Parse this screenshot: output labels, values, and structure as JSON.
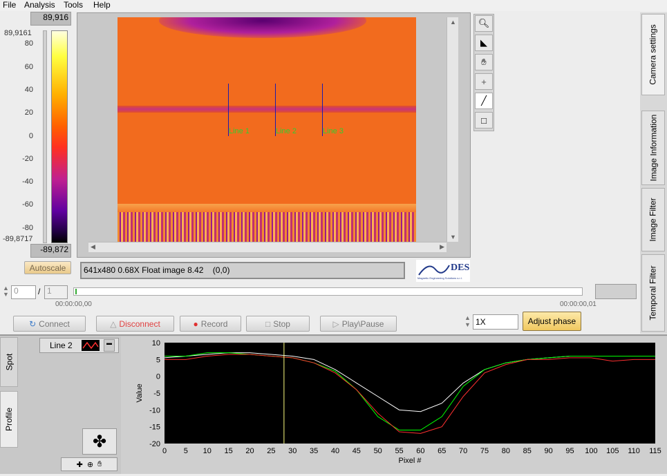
{
  "menu": [
    "File",
    "Analysis",
    "Tools",
    "Help"
  ],
  "colorbar": {
    "max_label": "89,916",
    "min_label": "-89,872",
    "upper_value": "89,9161",
    "lower_value": "-89,8717",
    "ticks": [
      "80",
      "60",
      "40",
      "20",
      "0",
      "-20",
      "-40",
      "-60",
      "-80"
    ]
  },
  "autoscale_label": "Autoscale",
  "image_info": "641x480 0.68X Float image 8.42    (0,0)",
  "lines": [
    "Line 1",
    "Line 2",
    "Line 3"
  ],
  "logo_text": "DES",
  "logo_subtitle": "Magnetic Engineering Solutions s.r.l.",
  "frame": {
    "current": "0",
    "separator": "/",
    "total": "1",
    "time_start": "00:00:00,00",
    "time_end": "00:00:00,01"
  },
  "buttons": {
    "connect": "Connect",
    "disconnect": "Disconnect",
    "record": "Record",
    "stop": "Stop",
    "play_pause": "Play\\Pause",
    "adjust_phase": "Adjust phase"
  },
  "speed_value": "1X",
  "right_tabs": [
    "Camera settings",
    "Image Information",
    "Image Filter",
    "Temporal Filter"
  ],
  "left_tabs": [
    "Spot",
    "Profile"
  ],
  "legend_line": "Line 2",
  "colors": {
    "chart_bg": "#000000",
    "series_white": "#ffffff",
    "series_green": "#00ff00",
    "series_red": "#ff3030",
    "cursor": "#ffff80",
    "accent": "#f5d36b"
  },
  "chart_data": {
    "type": "line",
    "xlabel": "Pixel #",
    "ylabel": "Value",
    "xlim": [
      0,
      115
    ],
    "ylim": [
      -20,
      10
    ],
    "xticks": [
      0,
      5,
      10,
      15,
      20,
      25,
      30,
      35,
      40,
      45,
      50,
      55,
      60,
      65,
      70,
      75,
      80,
      85,
      90,
      95,
      100,
      105,
      110,
      115
    ],
    "yticks": [
      10,
      5,
      0,
      -5,
      -10,
      -15,
      -20
    ],
    "cursor_x": 28,
    "x": [
      0,
      5,
      10,
      15,
      20,
      25,
      30,
      35,
      40,
      45,
      50,
      55,
      60,
      65,
      70,
      75,
      80,
      85,
      90,
      95,
      100,
      105,
      110,
      115
    ],
    "series": [
      {
        "color": "white",
        "values": [
          5.5,
          6,
          6.5,
          7,
          7,
          6.5,
          6,
          5,
          2,
          -2,
          -6,
          -10,
          -10.5,
          -8,
          -2,
          2,
          4,
          5,
          5.5,
          6,
          6,
          6,
          6,
          6
        ]
      },
      {
        "color": "green",
        "values": [
          6,
          6,
          7,
          7,
          6.5,
          6,
          5.5,
          4,
          1.5,
          -4,
          -12,
          -16,
          -16,
          -12,
          -3,
          2,
          4,
          5,
          5.5,
          6,
          6,
          6,
          6,
          6
        ]
      },
      {
        "color": "red",
        "values": [
          5,
          5,
          6,
          6.5,
          6.5,
          6,
          5.5,
          4,
          1,
          -4,
          -11,
          -16.5,
          -17,
          -15,
          -6,
          1,
          3.5,
          5,
          5,
          5.5,
          5.5,
          4.5,
          5,
          5
        ]
      }
    ]
  }
}
